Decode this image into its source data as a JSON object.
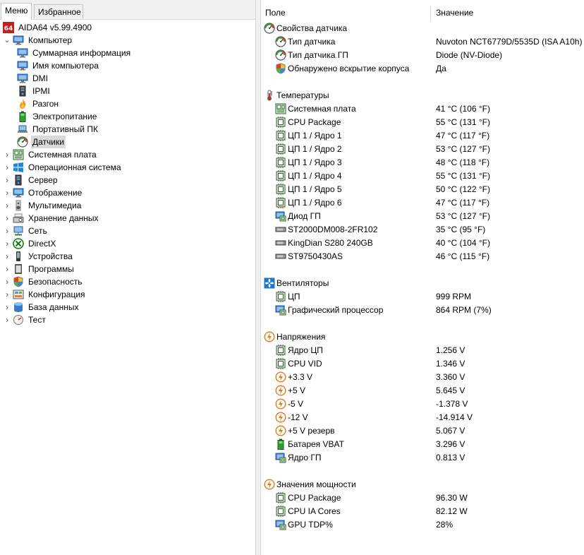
{
  "tabs": {
    "menu": "Меню",
    "favorites": "Избранное"
  },
  "tree": [
    {
      "label": "AIDA64 v5.99.4900",
      "icon": "aida64-logo-icon",
      "level": 0,
      "expander": ""
    },
    {
      "label": "Компьютер",
      "icon": "computer-icon",
      "level": 0,
      "expander": "open"
    },
    {
      "label": "Суммарная информация",
      "icon": "computer-icon",
      "level": 1,
      "expander": ""
    },
    {
      "label": "Имя компьютера",
      "icon": "computer-icon",
      "level": 1,
      "expander": ""
    },
    {
      "label": "DMI",
      "icon": "computer-icon",
      "level": 1,
      "expander": ""
    },
    {
      "label": "IPMI",
      "icon": "server-tower-icon",
      "level": 1,
      "expander": ""
    },
    {
      "label": "Разгон",
      "icon": "flame-icon",
      "level": 1,
      "expander": ""
    },
    {
      "label": "Электропитание",
      "icon": "battery-icon",
      "level": 1,
      "expander": ""
    },
    {
      "label": "Портативный ПК",
      "icon": "laptop-icon",
      "level": 1,
      "expander": ""
    },
    {
      "label": "Датчики",
      "icon": "gauge-icon",
      "level": 1,
      "expander": "",
      "selected": true
    },
    {
      "label": "Системная плата",
      "icon": "motherboard-icon",
      "level": 0,
      "expander": "closed"
    },
    {
      "label": "Операционная система",
      "icon": "windows-logo-icon",
      "level": 0,
      "expander": "closed"
    },
    {
      "label": "Сервер",
      "icon": "server-tower-icon",
      "level": 0,
      "expander": "closed"
    },
    {
      "label": "Отображение",
      "icon": "monitor-icon",
      "level": 0,
      "expander": "closed"
    },
    {
      "label": "Мультимедиа",
      "icon": "speaker-icon",
      "level": 0,
      "expander": "closed"
    },
    {
      "label": "Хранение данных",
      "icon": "storage-icon",
      "level": 0,
      "expander": "closed"
    },
    {
      "label": "Сеть",
      "icon": "network-icon",
      "level": 0,
      "expander": "closed"
    },
    {
      "label": "DirectX",
      "icon": "xbox-logo-icon",
      "level": 0,
      "expander": "closed"
    },
    {
      "label": "Устройства",
      "icon": "device-icon",
      "level": 0,
      "expander": "closed"
    },
    {
      "label": "Программы",
      "icon": "programs-icon",
      "level": 0,
      "expander": "closed"
    },
    {
      "label": "Безопасность",
      "icon": "shield-icon",
      "level": 0,
      "expander": "closed"
    },
    {
      "label": "Конфигурация",
      "icon": "config-icon",
      "level": 0,
      "expander": "closed"
    },
    {
      "label": "База данных",
      "icon": "database-icon",
      "level": 0,
      "expander": "closed"
    },
    {
      "label": "Тест",
      "icon": "benchmark-icon",
      "level": 0,
      "expander": "closed"
    }
  ],
  "columns": {
    "field": "Поле",
    "value": "Значение"
  },
  "sections": [
    {
      "title": "Свойства датчика",
      "icon": "gauge-icon",
      "items": [
        {
          "field": "Тип датчика",
          "value": "Nuvoton NCT6779D/5535D  (ISA A10h)",
          "icon": "gauge-icon"
        },
        {
          "field": "Тип датчика ГП",
          "value": "Diode  (NV-Diode)",
          "icon": "gauge-icon"
        },
        {
          "field": "Обнаружено вскрытие корпуса",
          "value": "Да",
          "icon": "shield-icon"
        }
      ]
    },
    {
      "title": "Температуры",
      "icon": "thermometer-icon",
      "items": [
        {
          "field": "Системная плата",
          "value": "41 °C  (106 °F)",
          "icon": "motherboard-icon"
        },
        {
          "field": "CPU Package",
          "value": "55 °C  (131 °F)",
          "icon": "cpu-chip-icon"
        },
        {
          "field": "ЦП 1 / Ядро 1",
          "value": "47 °C  (117 °F)",
          "icon": "cpu-chip-icon"
        },
        {
          "field": "ЦП 1 / Ядро 2",
          "value": "53 °C  (127 °F)",
          "icon": "cpu-chip-icon"
        },
        {
          "field": "ЦП 1 / Ядро 3",
          "value": "48 °C  (118 °F)",
          "icon": "cpu-chip-icon"
        },
        {
          "field": "ЦП 1 / Ядро 4",
          "value": "55 °C  (131 °F)",
          "icon": "cpu-chip-icon"
        },
        {
          "field": "ЦП 1 / Ядро 5",
          "value": "50 °C  (122 °F)",
          "icon": "cpu-chip-icon"
        },
        {
          "field": "ЦП 1 / Ядро 6",
          "value": "47 °C  (117 °F)",
          "icon": "cpu-chip-icon"
        },
        {
          "field": "Диод ГП",
          "value": "53 °C  (127 °F)",
          "icon": "gpu-icon"
        },
        {
          "field": "ST2000DM008-2FR102",
          "value": "35 °C  (95 °F)",
          "icon": "hard-drive-icon"
        },
        {
          "field": "KingDian S280 240GB",
          "value": "40 °C  (104 °F)",
          "icon": "hard-drive-icon"
        },
        {
          "field": "ST9750430AS",
          "value": "46 °C  (115 °F)",
          "icon": "hard-drive-icon"
        }
      ]
    },
    {
      "title": "Вентиляторы",
      "icon": "fan-icon",
      "items": [
        {
          "field": "ЦП",
          "value": "999 RPM",
          "icon": "cpu-chip-icon"
        },
        {
          "field": "Графический процессор",
          "value": "864 RPM  (7%)",
          "icon": "gpu-icon"
        }
      ]
    },
    {
      "title": "Напряжения",
      "icon": "voltage-icon",
      "items": [
        {
          "field": "Ядро ЦП",
          "value": "1.256 V",
          "icon": "cpu-chip-icon"
        },
        {
          "field": "CPU VID",
          "value": "1.346 V",
          "icon": "cpu-chip-icon"
        },
        {
          "field": "+3.3 V",
          "value": "3.360 V",
          "icon": "voltage-icon"
        },
        {
          "field": "+5 V",
          "value": "5.645 V",
          "icon": "voltage-icon"
        },
        {
          "field": "-5 V",
          "value": "-1.378 V",
          "icon": "voltage-icon"
        },
        {
          "field": "-12 V",
          "value": "-14.914 V",
          "icon": "voltage-icon"
        },
        {
          "field": "+5 V резерв",
          "value": "5.067 V",
          "icon": "voltage-icon"
        },
        {
          "field": "Батарея VBAT",
          "value": "3.296 V",
          "icon": "battery-icon"
        },
        {
          "field": "Ядро ГП",
          "value": "0.813 V",
          "icon": "gpu-icon"
        }
      ]
    },
    {
      "title": "Значения мощности",
      "icon": "voltage-icon",
      "items": [
        {
          "field": "CPU Package",
          "value": "96.30 W",
          "icon": "cpu-chip-icon"
        },
        {
          "field": "CPU IA Cores",
          "value": "82.12 W",
          "icon": "cpu-chip-icon"
        },
        {
          "field": "GPU TDP%",
          "value": "28%",
          "icon": "gpu-icon"
        }
      ]
    }
  ]
}
